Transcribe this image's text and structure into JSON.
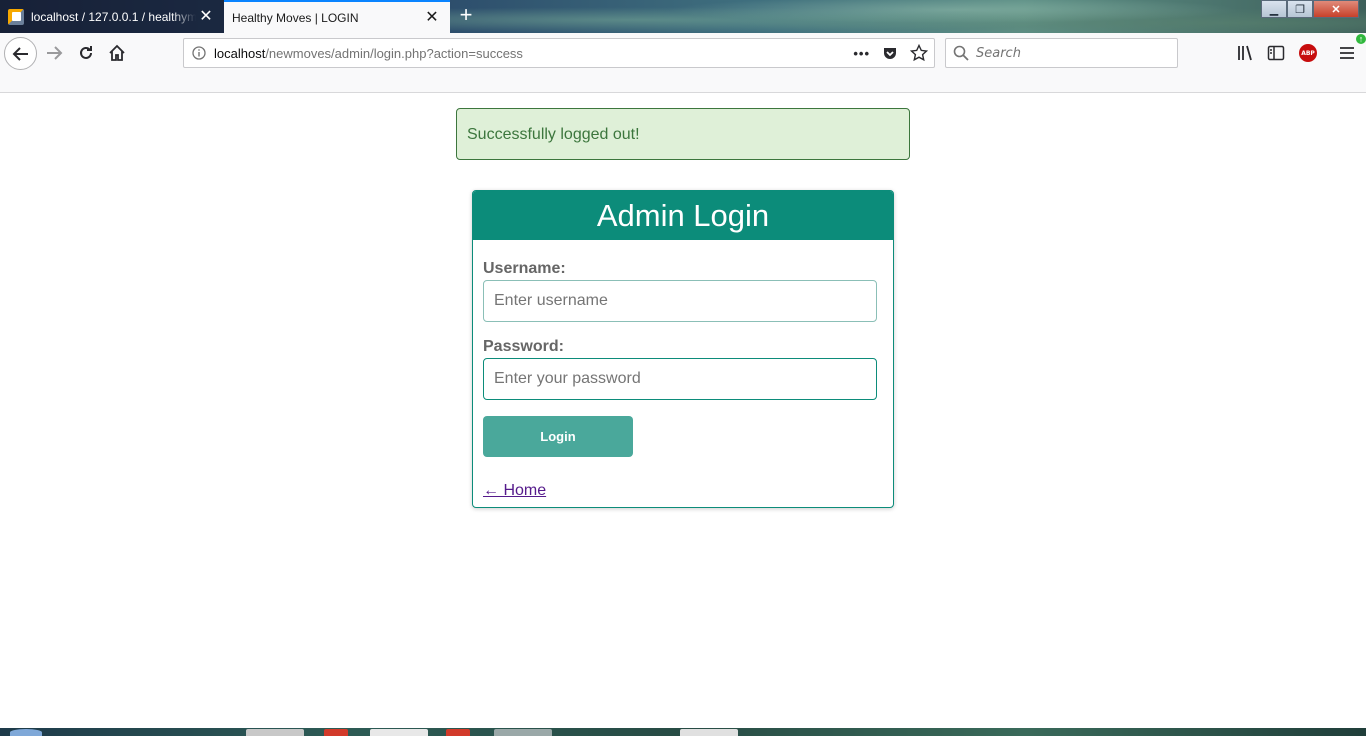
{
  "browser": {
    "tabs": [
      {
        "title": "localhost / 127.0.0.1 / healthym",
        "active": false
      },
      {
        "title": "Healthy Moves | LOGIN",
        "active": true
      }
    ],
    "url": {
      "host": "localhost",
      "path": "/newmoves/admin/login.php?action=success"
    },
    "search_placeholder": "Search",
    "adblock_label": "ABP"
  },
  "alert": {
    "message": "Successfully logged out!"
  },
  "login_form": {
    "title": "Admin Login",
    "username_label": "Username:",
    "username_placeholder": "Enter username",
    "password_label": "Password:",
    "password_placeholder": "Enter your password",
    "login_button": "Login",
    "home_link": "← Home"
  },
  "colors": {
    "brand_teal": "#0c8c7a",
    "button_teal": "#4aa89b",
    "alert_bg": "#dff0d8",
    "alert_text": "#3c763d",
    "visited_link": "#551a8b"
  }
}
